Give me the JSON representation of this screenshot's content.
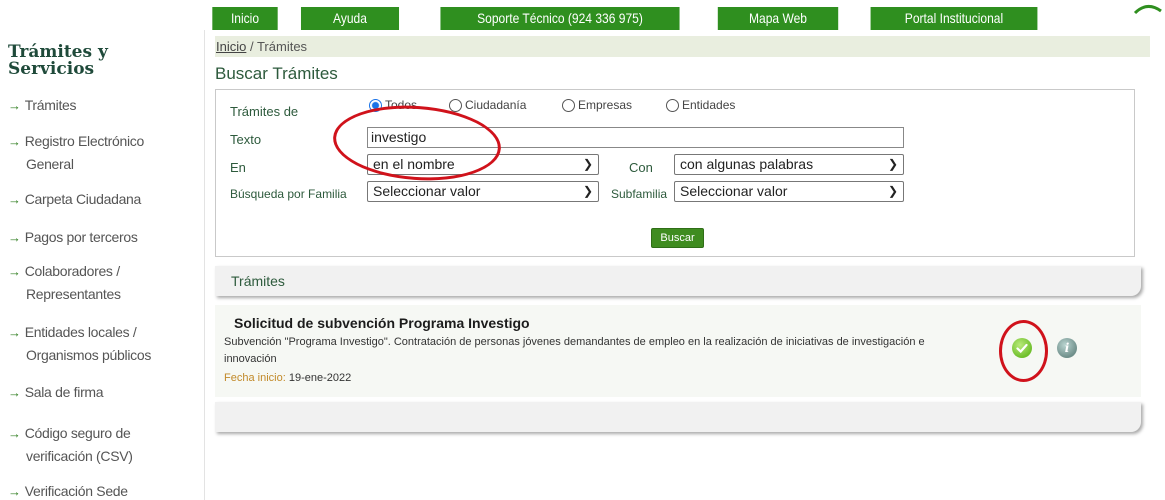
{
  "nav": {
    "items": [
      {
        "label": "Inicio"
      },
      {
        "label": "Ayuda"
      },
      {
        "label": "Soporte Técnico (924 336 975)"
      },
      {
        "label": "Mapa Web"
      },
      {
        "label": "Portal Institucional"
      }
    ],
    "color": "#2f8f1f"
  },
  "sidebar": {
    "title": "Trámites y Servicios",
    "items": [
      {
        "label": "Trámites"
      },
      {
        "label": "Registro Electrónico",
        "label2": "General"
      },
      {
        "label": "Carpeta Ciudadana"
      },
      {
        "label": "Pagos por terceros"
      },
      {
        "label": "Colaboradores /",
        "label2": "Representantes"
      },
      {
        "label": "Entidades locales /",
        "label2": "Organismos públicos"
      },
      {
        "label": "Sala de firma"
      },
      {
        "label": "Código seguro de",
        "label2": "verificación (CSV)"
      },
      {
        "label": "Verificación Sede"
      }
    ]
  },
  "breadcrumb": {
    "home": "Inicio",
    "separator": " / ",
    "current": "Trámites"
  },
  "page_title": "Buscar Trámites",
  "search": {
    "tramites_de_label": "Trámites de",
    "radios": [
      {
        "label": "Todos",
        "checked": true
      },
      {
        "label": "Ciudadanía",
        "checked": false
      },
      {
        "label": "Empresas",
        "checked": false
      },
      {
        "label": "Entidades",
        "checked": false
      }
    ],
    "texto_label": "Texto",
    "texto_value": "investigo",
    "en_label": "En",
    "en_value": "en el nombre",
    "con_label": "Con",
    "con_value": "con algunas palabras",
    "familia_label": "Búsqueda por Familia",
    "familia_value": "Seleccionar valor",
    "subfamilia_label": "Subfamilia",
    "subfamilia_value": "Seleccionar valor",
    "button": "Buscar"
  },
  "results": {
    "header": "Trámites",
    "items": [
      {
        "title": "Solicitud de subvención Programa Investigo",
        "description": "Subvención \"Programa Investigo\". Contratación de personas jóvenes demandantes de empleo en la realización de iniciativas de investigación e innovación",
        "date_label": "Fecha inicio:",
        "date_value": "19-ene-2022",
        "icons": [
          "check-icon",
          "info-icon"
        ]
      }
    ]
  },
  "annotation_color": "#d0121b"
}
